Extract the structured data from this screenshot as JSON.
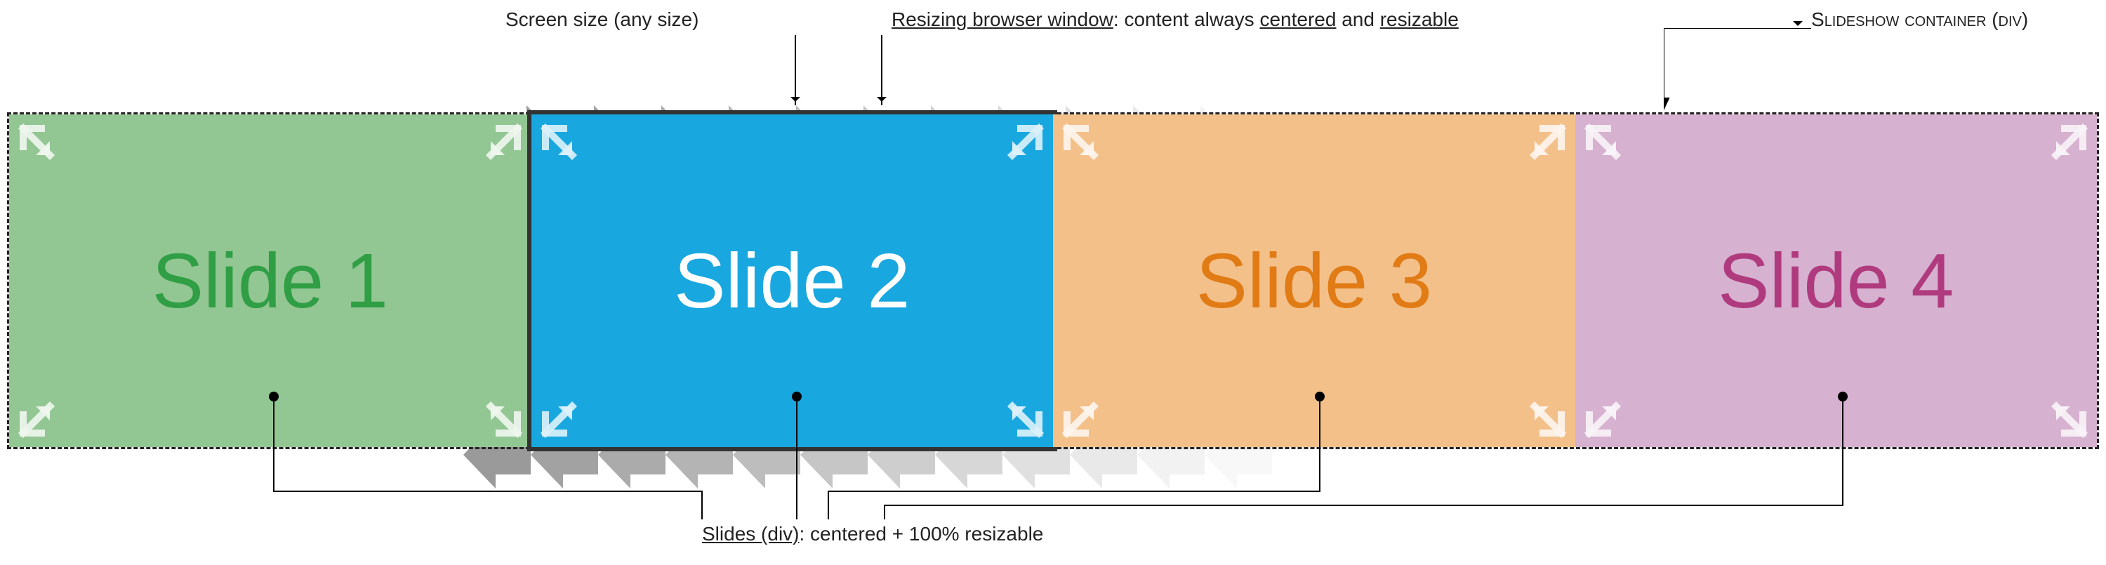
{
  "annotations": {
    "screen_size": "Screen size (any size)",
    "resize_prefix": "Resizing browser window",
    "resize_mid": ": content always ",
    "resize_c": "centered",
    "resize_and": " and ",
    "resize_r": "resizable",
    "container_label_pre": "S",
    "container_label_rest": "lideshow container (div)",
    "slides_prefix": "Slides (div)",
    "slides_rest": ": centered + 100% resizable"
  },
  "slides": [
    {
      "label": "Slide 1",
      "bg": "#92C692",
      "fg": "#2F9E44"
    },
    {
      "label": "Slide 2",
      "bg": "#19A7E0",
      "fg": "#FFFFFF"
    },
    {
      "label": "Slide 3",
      "bg": "#F3C08A",
      "fg": "#E17B15"
    },
    {
      "label": "Slide 4",
      "bg": "#D6B1D0",
      "fg": "#B03A7E"
    }
  ],
  "viewport_slide_index": 1,
  "motion_direction": "left"
}
